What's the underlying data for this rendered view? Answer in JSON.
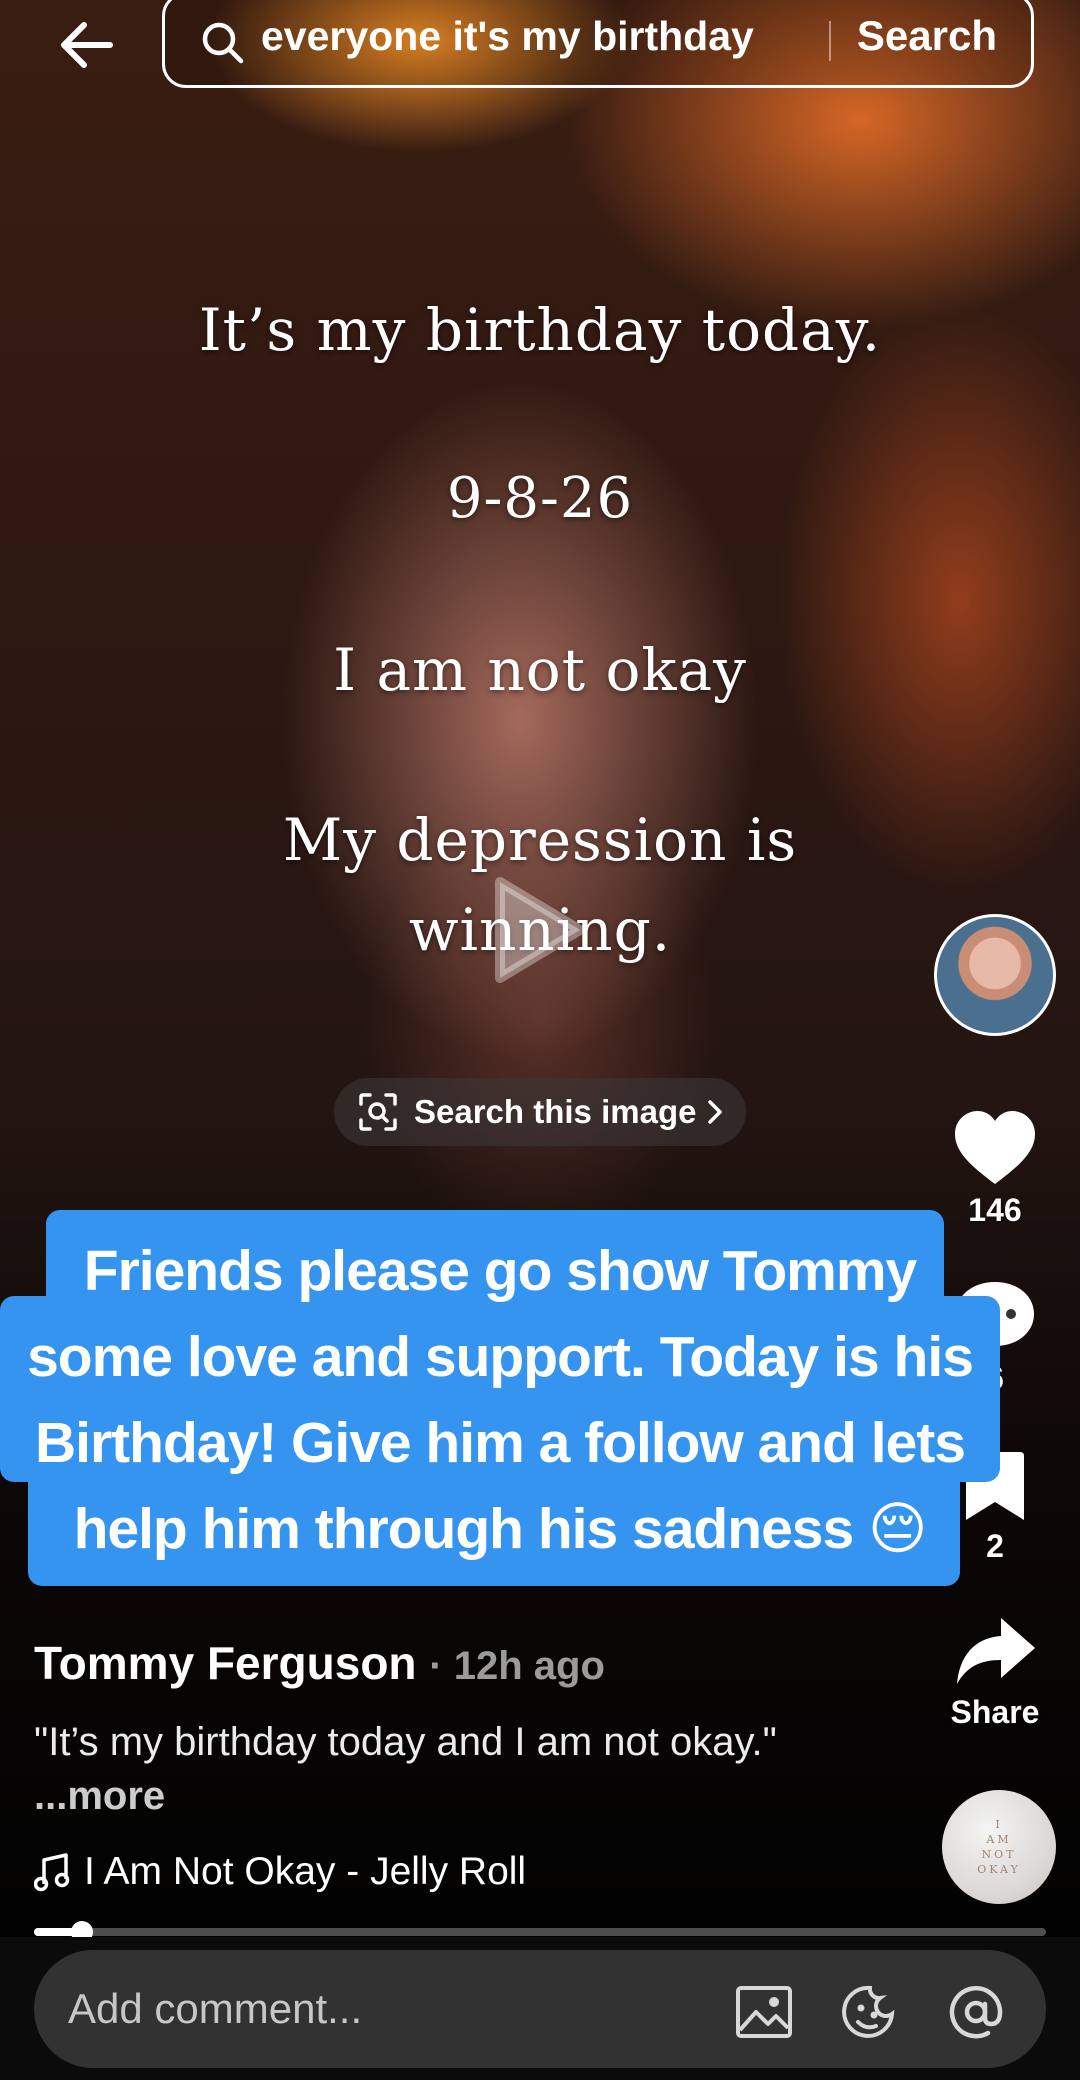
{
  "header": {
    "search_query": "everyone it's my birthday",
    "search_button": "Search"
  },
  "video_overlay": {
    "line1": "It’s my birthday today.",
    "line2": "9-8-26",
    "line3": "I am not okay",
    "line4": "My depression is",
    "line5": "winning."
  },
  "search_image_label": "Search this image",
  "caption_bubble": {
    "line1": "Friends please go show Tommy",
    "line2": "some love and support. Today is his",
    "line3": "Birthday! Give him a follow and lets",
    "line4": "help him through his sadness 😔"
  },
  "actions": {
    "likes": "146",
    "comments": "6",
    "saves": "2",
    "share_label": "Share"
  },
  "post": {
    "author": "Tommy Ferguson",
    "time": "· 12h ago",
    "description": "\"It’s my birthday today and I am not okay.\"",
    "more": "...more",
    "song": "I Am Not Okay - Jelly Roll"
  },
  "music_disc_text": [
    "I",
    "AM",
    "NOT",
    "OKAY"
  ],
  "playback_progress": 0.047,
  "comment_bar": {
    "placeholder": "Add comment..."
  },
  "colors": {
    "caption_bubble": "#3494f0",
    "comment_bar_bg": "#333232"
  },
  "icons": [
    "back-arrow-icon",
    "search-icon",
    "play-icon",
    "image-scan-icon",
    "heart-icon",
    "comment-icon",
    "bookmark-icon",
    "share-icon",
    "music-note-icon",
    "image-icon",
    "emoji-icon",
    "at-icon"
  ]
}
